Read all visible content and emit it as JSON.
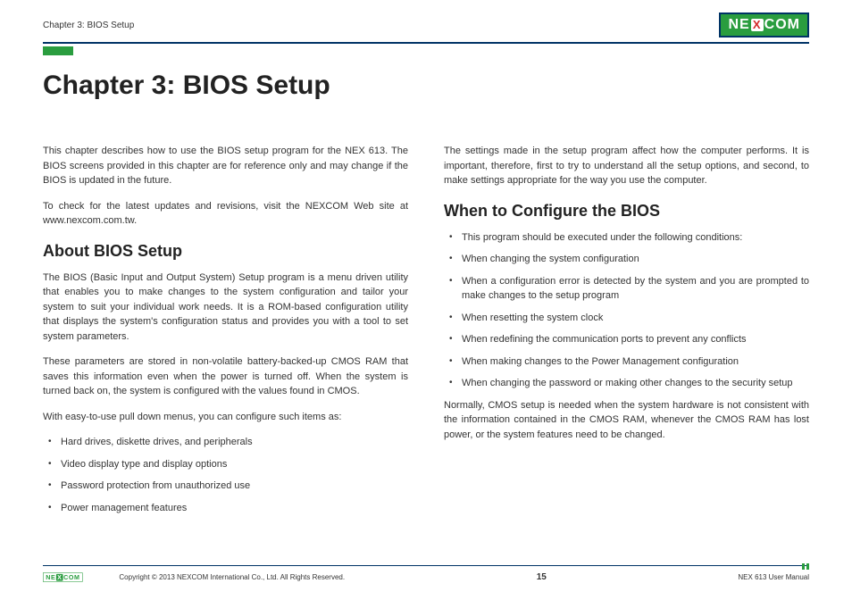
{
  "header": {
    "breadcrumb": "Chapter 3: BIOS Setup",
    "logo_text_pre": "NE",
    "logo_text_x": "X",
    "logo_text_post": "COM"
  },
  "title": "Chapter 3: BIOS Setup",
  "left_column": {
    "intro1": "This chapter describes how to use the BIOS setup program for the NEX 613. The BIOS screens provided in this chapter are for reference only and may change if the BIOS is updated in the future.",
    "intro2": "To check for the latest updates and revisions, visit the NEXCOM Web site at www.nexcom.com.tw.",
    "heading1": "About BIOS Setup",
    "para1": "The BIOS (Basic Input and Output System) Setup program is a menu driven utility that enables you to make changes to the system configuration and tailor your system to suit your individual work needs. It is a ROM-based configuration utility that displays the system's configuration status and provides you with a tool to set system parameters.",
    "para2": "These parameters are stored in non-volatile battery-backed-up CMOS RAM that saves this information even when the power is turned off. When the system is turned back on, the system is configured with the values found in CMOS.",
    "para3": "With easy-to-use pull down menus, you can configure such items as:",
    "bullets": [
      "Hard drives, diskette drives, and peripherals",
      "Video display type and display options",
      "Password protection from unauthorized use",
      "Power management features"
    ]
  },
  "right_column": {
    "intro": "The settings made in the setup program affect how the computer performs. It is important, therefore, first to try to understand all the setup options, and second, to make settings appropriate for the way you use the computer.",
    "heading1": "When to Configure the BIOS",
    "bullets": [
      "This program should be executed under the following conditions:",
      "When changing the system configuration",
      "When a configuration error is detected by the system and you are prompted to make changes to the setup program",
      "When resetting the system clock",
      "When redefining the communication ports to prevent any conflicts",
      "When making changes to the Power Management configuration",
      "When changing the password or making other changes to the security setup"
    ],
    "para_end": "Normally, CMOS setup is needed when the system hardware is not consistent with the information contained in the CMOS RAM, whenever the CMOS RAM has lost power, or the system features need to be changed."
  },
  "footer": {
    "copyright": "Copyright © 2013 NEXCOM International Co., Ltd. All Rights Reserved.",
    "page_number": "15",
    "manual_name": "NEX 613 User Manual"
  }
}
